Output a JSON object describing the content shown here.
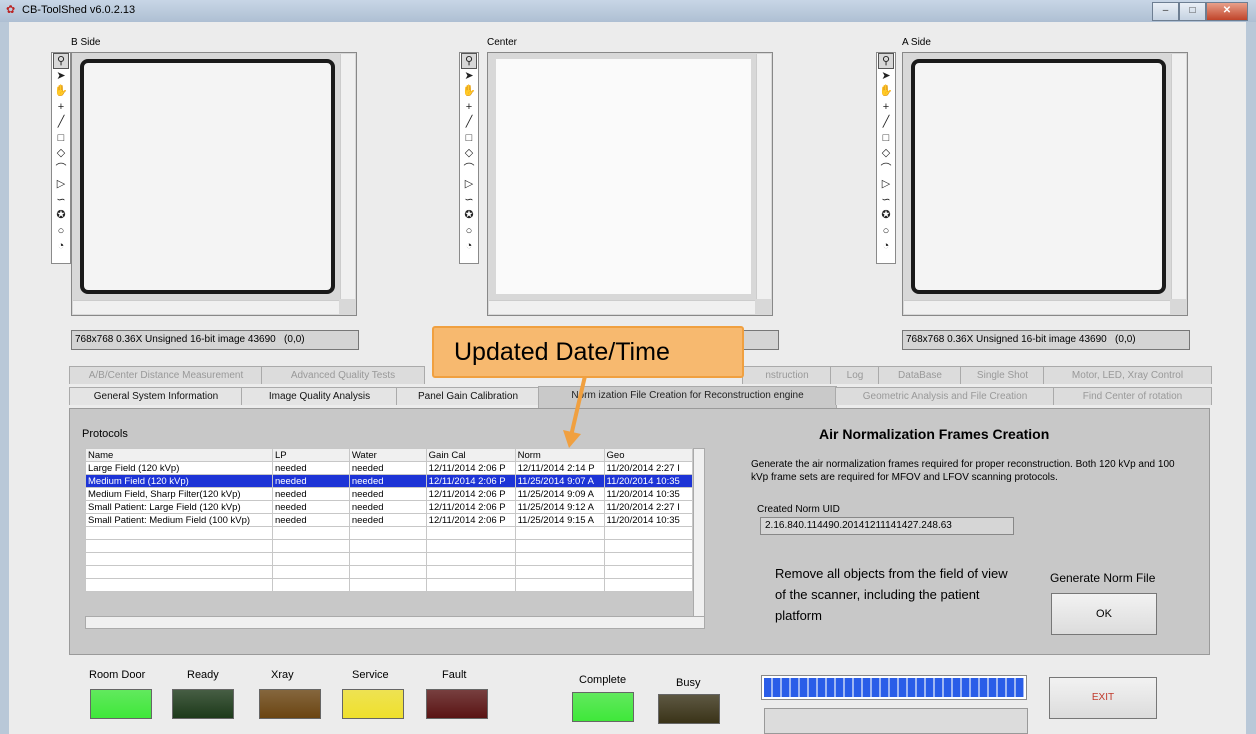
{
  "window": {
    "title": "CB-ToolShed v6.0.2.13",
    "controls": [
      "–",
      "□",
      "✕"
    ]
  },
  "viewers": {
    "b_side": {
      "label": "B Side",
      "info": "768x768 0.36X Unsigned 16-bit image 43690",
      "coords": "(0,0)"
    },
    "center": {
      "label": "Center"
    },
    "a_side": {
      "label": "A Side",
      "info": "768x768 0.36X Unsigned 16-bit image 43690",
      "coords": "(0,0)"
    }
  },
  "tabs": {
    "back_row": [
      "A/B/Center Distance Measurement",
      "Advanced Quality Tests",
      "nstruction",
      "Log",
      "DataBase",
      "Single Shot",
      "Motor, LED, Xray Control"
    ],
    "front_row": [
      "General System Information",
      "Image Quality Analysis",
      "Panel Gain Calibration",
      "Norm   ization File Creation for Reconstruction engine",
      "Geometric Analysis and File Creation",
      "Find Center of rotation"
    ]
  },
  "callout": {
    "text": "Updated Date/Time"
  },
  "protocols": {
    "title": "Protocols",
    "columns": [
      "Name",
      "LP",
      "Water",
      "Gain Cal",
      "Norm",
      "Geo"
    ],
    "rows": [
      [
        "Large Field (120 kVp)",
        "needed",
        "needed",
        "12/11/2014 2:06 P",
        "12/11/2014 2:14 P",
        "11/20/2014 2:27 I"
      ],
      [
        "Medium Field (120 kVp)",
        "needed",
        "needed",
        "12/11/2014 2:06 P",
        "11/25/2014 9:07 A",
        "11/20/2014 10:35"
      ],
      [
        "Medium Field, Sharp Filter(120 kVp)",
        "needed",
        "needed",
        "12/11/2014 2:06 P",
        "11/25/2014 9:09 A",
        "11/20/2014 10:35"
      ],
      [
        "Small Patient: Large Field (120 kVp)",
        "needed",
        "needed",
        "12/11/2014 2:06 P",
        "11/25/2014 9:12 A",
        "11/20/2014 2:27 I"
      ],
      [
        "Small Patient: Medium Field (100 kVp)",
        "needed",
        "needed",
        "12/11/2014 2:06 P",
        "11/25/2014 9:15 A",
        "11/20/2014 10:35"
      ]
    ],
    "selected_row": 1
  },
  "air_norm": {
    "title": "Air Normalization Frames Creation",
    "description": "Generate the air normalization frames required for proper reconstruction. Both 120 kVp and 100 kVp frame sets are required for MFOV and LFOV scanning protocols.",
    "uid_label": "Created Norm UID",
    "uid_value": "2.16.840.114490.20141211141427.248.63",
    "instruction": "Remove all objects from the field of view of the scanner, including the patient platform",
    "generate_label": "Generate Norm File",
    "ok_label": "OK"
  },
  "indicators": [
    {
      "label": "Room Door",
      "color": "#3fe83a"
    },
    {
      "label": "Ready",
      "color": "#1d3a1a"
    },
    {
      "label": "Xray",
      "color": "#6b4512"
    },
    {
      "label": "Service",
      "color": "#efe02c"
    },
    {
      "label": "Fault",
      "color": "#5a1414"
    },
    {
      "label": "Complete",
      "color": "#3fe83a"
    },
    {
      "label": "Busy",
      "color": "#3a3318"
    }
  ],
  "exit_label": "EXIT"
}
